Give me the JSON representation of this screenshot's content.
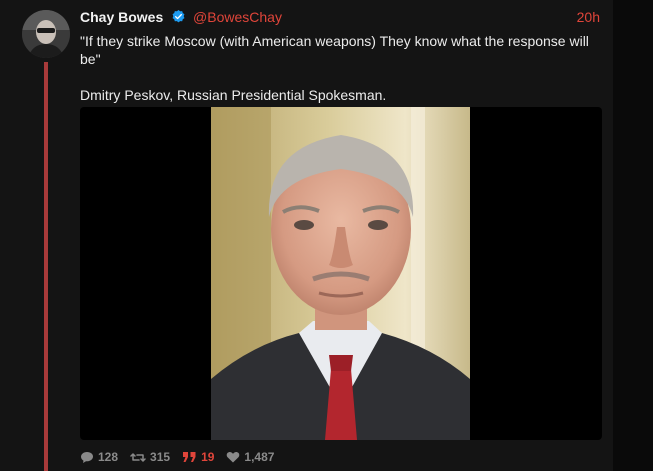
{
  "post": {
    "author_name": "Chay Bowes",
    "handle": "@BowesChay",
    "time": "20h",
    "text_line1": "\"If they strike Moscow (with American weapons) They know what the response will be\"",
    "text_line2": "Dmitry Peskov,  Russian Presidential Spokesman."
  },
  "actions": {
    "replies": "128",
    "reposts": "315",
    "quotes": "19",
    "likes": "1,487"
  },
  "colors": {
    "accent": "#e0453a",
    "thread_line": "#a83a3a",
    "verified": "#1d9bf0"
  },
  "icons": {
    "reply": "speech-bubble-icon",
    "repost": "repost-arrows-icon",
    "quote": "quote-marks-icon",
    "like": "heart-icon",
    "verified": "verified-badge-icon"
  }
}
